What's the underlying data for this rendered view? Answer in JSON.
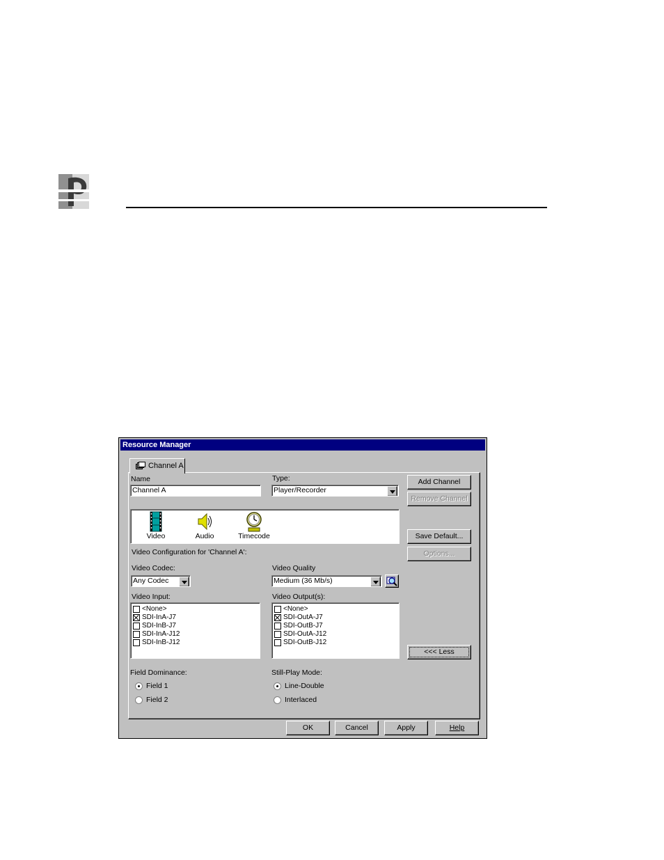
{
  "dialog": {
    "title": "Resource Manager",
    "tab_label": "Channel A",
    "name_label": "Name",
    "name_value": "Channel A",
    "type_label": "Type:",
    "type_value": "Player/Recorder",
    "buttons": {
      "add_channel": "Add Channel",
      "remove_channel": "Remove Channel",
      "save_default": "Save Default...",
      "options": "Options...",
      "less": "<<< Less",
      "ok": "OK",
      "cancel": "Cancel",
      "apply": "Apply",
      "help": "Help"
    },
    "resources": [
      {
        "label": "Video",
        "icon": "film-icon"
      },
      {
        "label": "Audio",
        "icon": "speaker-icon"
      },
      {
        "label": "Timecode",
        "icon": "clock-icon"
      }
    ],
    "config_heading": "Video Configuration for 'Channel A':",
    "video_codec_label": "Video Codec:",
    "video_codec_value": "Any Codec",
    "video_quality_label": "Video Quality",
    "video_quality_value": "Medium (36 Mb/s)",
    "video_input_label": "Video Input:",
    "video_inputs": [
      {
        "label": "<None>",
        "checked": false
      },
      {
        "label": "SDI-InA-J7",
        "checked": true
      },
      {
        "label": "SDI-InB-J7",
        "checked": false
      },
      {
        "label": "SDI-InA-J12",
        "checked": false
      },
      {
        "label": "SDI-InB-J12",
        "checked": false
      }
    ],
    "video_output_label": "Video Output(s):",
    "video_outputs": [
      {
        "label": "<None>",
        "checked": false
      },
      {
        "label": "SDI-OutA-J7",
        "checked": true
      },
      {
        "label": "SDI-OutB-J7",
        "checked": false
      },
      {
        "label": "SDI-OutA-J12",
        "checked": false
      },
      {
        "label": "SDI-OutB-J12",
        "checked": false
      }
    ],
    "field_dominance_label": "Field Dominance:",
    "field_options": [
      {
        "label": "Field 1",
        "selected": true
      },
      {
        "label": "Field 2",
        "selected": false
      }
    ],
    "still_play_label": "Still-Play Mode:",
    "still_play_options": [
      {
        "label": "Line-Double",
        "selected": true
      },
      {
        "label": "Interlaced",
        "selected": false
      }
    ]
  },
  "colors": {
    "titlebar": "#000080",
    "face": "#c0c0c0"
  }
}
